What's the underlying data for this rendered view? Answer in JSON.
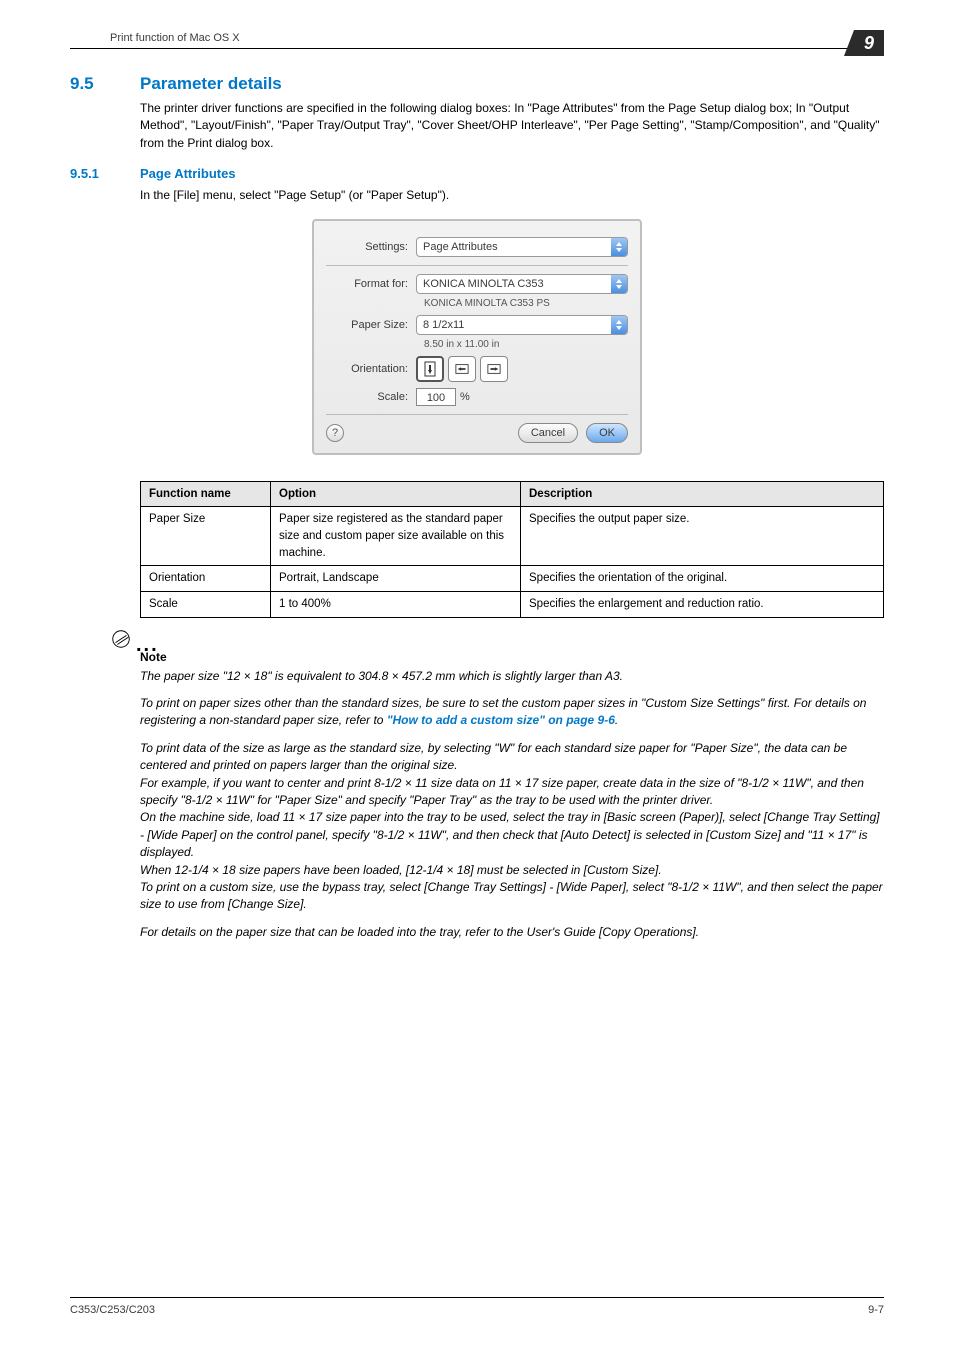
{
  "header": {
    "breadcrumb": "Print function of Mac OS X",
    "chapter": "9"
  },
  "h2": {
    "num": "9.5",
    "title": "Parameter details"
  },
  "intro": "The printer driver functions are specified in the following dialog boxes: In \"Page Attributes\" from the Page Setup dialog box; In \"Output Method\", \"Layout/Finish\", \"Paper Tray/Output Tray\", \"Cover Sheet/OHP Interleave\", \"Per Page Setting\", \"Stamp/Composition\", and \"Quality\" from the Print dialog box.",
  "h3": {
    "num": "9.5.1",
    "title": "Page Attributes"
  },
  "instruction": "In the [File] menu, select \"Page Setup\" (or \"Paper Setup\").",
  "dialog": {
    "settings_label": "Settings:",
    "settings_value": "Page Attributes",
    "format_label": "Format for:",
    "format_value": "KONICA MINOLTA C353",
    "format_sub": "KONICA MINOLTA C353 PS",
    "papersize_label": "Paper Size:",
    "papersize_value": "8 1/2x11",
    "papersize_sub": "8.50 in x 11.00 in",
    "orientation_label": "Orientation:",
    "scale_label": "Scale:",
    "scale_value": "100",
    "scale_unit": "%",
    "cancel": "Cancel",
    "ok": "OK",
    "help": "?"
  },
  "table": {
    "headers": [
      "Function name",
      "Option",
      "Description"
    ],
    "rows": [
      [
        "Paper Size",
        "Paper size registered as the standard paper size and custom paper size available on this machine.",
        "Specifies the output paper size."
      ],
      [
        "Orientation",
        "Portrait, Landscape",
        "Specifies the orientation of the original."
      ],
      [
        "Scale",
        "1 to 400%",
        "Specifies the enlargement and reduction ratio."
      ]
    ]
  },
  "note": {
    "label": "Note",
    "p1": "The paper size \"12 × 18\" is equivalent to 304.8 × 457.2 mm which is slightly larger than A3.",
    "p2_a": "To print on paper sizes other than the standard sizes, be sure to set the custom paper sizes in \"Custom Size Settings\" first. For details on registering a non-standard paper size, refer to ",
    "p2_link": "\"How to add a custom size\" on page 9-6",
    "p2_b": ".",
    "p3": "To print data of the size as large as the standard size, by selecting \"W\" for each standard size paper for \"Paper Size\", the data can be centered and printed on papers larger than the original size.\nFor example, if you want to center and print 8-1/2 × 11 size data on 11 × 17 size paper, create data in the size of \"8-1/2 × 11W\", and then specify \"8-1/2 × 11W\" for \"Paper Size\" and specify \"Paper Tray\" as the tray to be used with the printer driver.\nOn the machine side, load 11 × 17 size paper into the tray to be used, select the tray in [Basic screen (Paper)], select [Change Tray Setting] - [Wide Paper] on the control panel, specify \"8-1/2 × 11W\", and then check that [Auto Detect] is selected in [Custom Size] and \"11 × 17\" is displayed.\nWhen 12-1/4 × 18 size papers have been loaded, [12-1/4 × 18] must be selected in [Custom Size].\nTo print on a custom size, use the bypass tray, select [Change Tray Settings] - [Wide Paper], select \"8-1/2 × 11W\", and then select the paper size to use from [Change Size].",
    "p4": "For details on the paper size that can be loaded into the tray, refer to the User's Guide [Copy Operations]."
  },
  "footer": {
    "left": "C353/C253/C203",
    "right": "9-7"
  }
}
